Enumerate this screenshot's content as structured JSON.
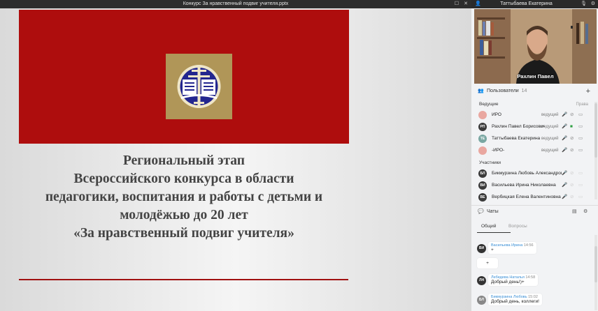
{
  "presentation": {
    "window_title": "Конкурс За нравственный подвиг учителя.pptx",
    "controls": {
      "restore": "☐",
      "close": "✕"
    },
    "slide_lines": [
      "Региональный этап",
      "Всероссийского конкурса в области",
      "педагогики, воспитания и работы с детьми и",
      "молодёжью до 20 лет",
      "«За нравственный подвиг учителя»"
    ]
  },
  "video": {
    "header_name": "Таттыбаева Екатерина",
    "speaker_name": "Рахлин Павел",
    "icons": {
      "person": "person-icon",
      "settings": "gear-icon"
    }
  },
  "users": {
    "header_label": "Пользователи",
    "count": "14",
    "presenters_label": "Ведущие",
    "rights_label": "Права",
    "participants_label": "Участники",
    "presenters": [
      {
        "initials": "",
        "name": "ИРО",
        "role": "ведущий"
      },
      {
        "initials": "РП",
        "name": "Рахлин Павел Борисович",
        "role": "ведущий"
      },
      {
        "initials": "ТЕ",
        "name": "Таттыбаева Екатерина",
        "role": "ведущий"
      },
      {
        "initials": "",
        "name": "-ИРО-",
        "role": "ведущий"
      }
    ],
    "participants": [
      {
        "initials": "БЛ",
        "name": "Бикмурзина Любовь Александровна"
      },
      {
        "initials": "ВИ",
        "name": "Васильева Ирина Николаевна"
      },
      {
        "initials": "ВЕ",
        "name": "Вербицкая Елена Валентиновна"
      }
    ]
  },
  "chat": {
    "header_label": "Чаты",
    "tabs": [
      "Общий",
      "Вопросы"
    ],
    "messages": [
      {
        "initials": "ВИ",
        "author": "Васильева Ирина",
        "time": "14:56",
        "text": "+"
      },
      {
        "initials": "",
        "author": "",
        "time": "",
        "text": "+"
      },
      {
        "initials": "ЛН",
        "author": "Лебедева Наталья",
        "time": "14:58",
        "text": "Добрый день!)+"
      },
      {
        "initials": "БЛ",
        "author": "Бикмурзина Любовь",
        "time": "15:02",
        "text": "Добрый день, коллеги!"
      }
    ]
  }
}
